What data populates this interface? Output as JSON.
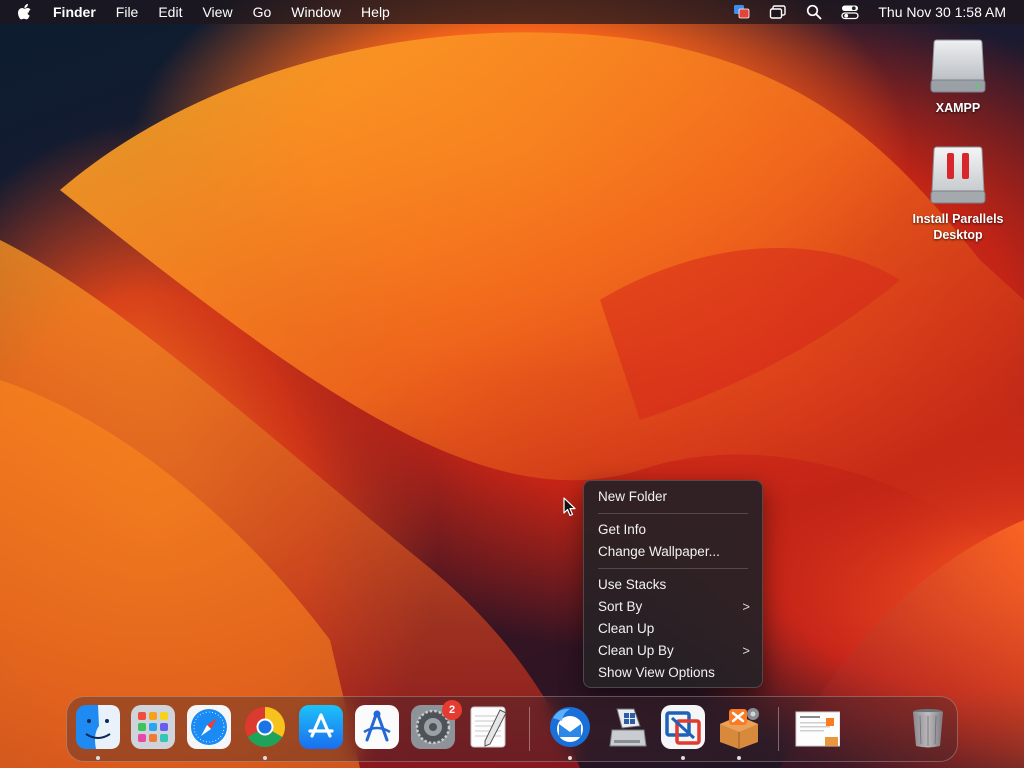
{
  "menubar": {
    "app_name": "Finder",
    "items": [
      "File",
      "Edit",
      "View",
      "Go",
      "Window",
      "Help"
    ],
    "clock": "Thu Nov 30  1:58 AM"
  },
  "desktop_icons": [
    {
      "label": "XAMPP",
      "icon": "drive-icon"
    },
    {
      "label": "Install Parallels Desktop",
      "icon": "parallels-installer-icon"
    }
  ],
  "context_menu": {
    "items": [
      {
        "label": "New Folder"
      },
      {
        "label": "Get Info"
      },
      {
        "label": "Change Wallpaper..."
      },
      {
        "label": "Use Stacks"
      },
      {
        "label": "Sort By",
        "submenu": true
      },
      {
        "label": "Clean Up"
      },
      {
        "label": "Clean Up By",
        "submenu": true
      },
      {
        "label": "Show View Options"
      }
    ],
    "chevron": ">"
  },
  "dock": {
    "apps": [
      {
        "name": "Finder",
        "icon": "finder-icon",
        "running": true
      },
      {
        "name": "Launchpad",
        "icon": "launchpad-icon",
        "running": false
      },
      {
        "name": "Safari",
        "icon": "safari-icon",
        "running": false
      },
      {
        "name": "Google Chrome",
        "icon": "chrome-icon",
        "running": true
      },
      {
        "name": "App Store",
        "icon": "app-store-icon",
        "running": false
      },
      {
        "name": "Instruments",
        "icon": "instruments-icon",
        "running": false
      },
      {
        "name": "System Settings",
        "icon": "settings-icon",
        "running": false,
        "badge": "2"
      },
      {
        "name": "TextEdit",
        "icon": "textedit-icon",
        "running": false
      },
      {
        "name": "Thunderbird",
        "icon": "thunderbird-icon",
        "running": true
      },
      {
        "name": "Boot Camp",
        "icon": "bootcamp-icon",
        "running": false
      },
      {
        "name": "VMware Fusion",
        "icon": "vmware-icon",
        "running": true
      },
      {
        "name": "XAMPP",
        "icon": "xampp-icon",
        "running": true
      },
      {
        "name": "Document",
        "icon": "document-preview-icon",
        "running": false
      },
      {
        "name": "Trash",
        "icon": "trash-icon",
        "running": false
      }
    ]
  },
  "colors": {
    "accent": "#e63b31",
    "menu_bg": "#262126"
  }
}
